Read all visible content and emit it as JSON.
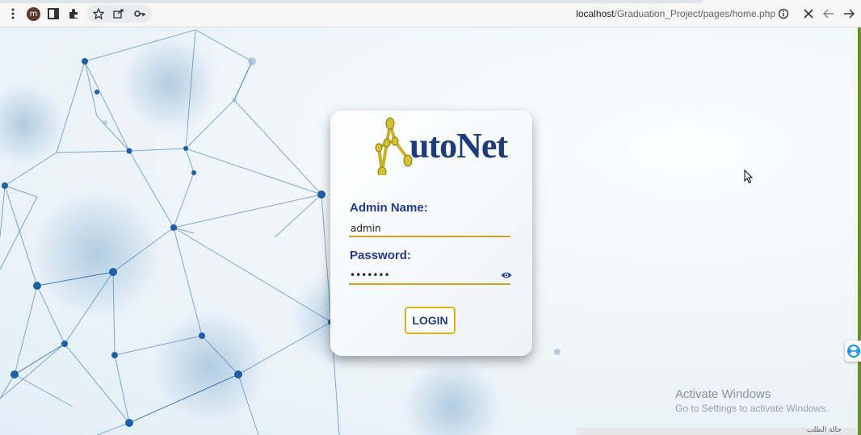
{
  "browser": {
    "profile_initial": "m",
    "url_host": "localhost",
    "url_path": "/Graduation_Project/pages/home.php",
    "icons": [
      "menu-icon",
      "profile-avatar",
      "sidebar-icon",
      "extensions-icon",
      "bookmark-star-icon",
      "install-app-icon",
      "password-key-icon",
      "site-info-icon",
      "close-icon",
      "back-icon",
      "forward-icon"
    ]
  },
  "login": {
    "logo_text": "utoNet",
    "admin_label": "Admin Name:",
    "admin_value": "admin",
    "password_label": "Password:",
    "password_masked": "•••••••",
    "login_button": "LOGIN"
  },
  "overlay": {
    "activate_title": "Activate Windows",
    "activate_subtitle": "Go to Settings to activate Windows.",
    "taskbar_text": "حالة الطلب"
  },
  "colors": {
    "accent_gold": "#c6a52a",
    "label_blue": "#243a8c",
    "network_blue": "#1f5fa8"
  }
}
